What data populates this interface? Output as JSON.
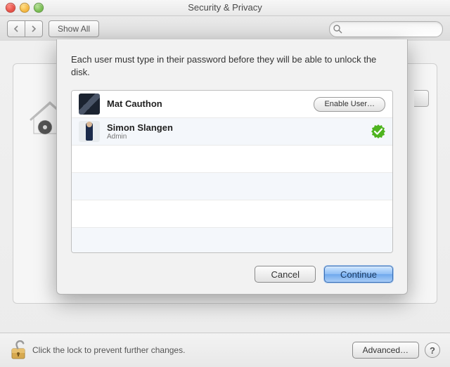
{
  "window": {
    "title": "Security & Privacy"
  },
  "toolbar": {
    "show_all": "Show All",
    "search_placeholder": ""
  },
  "sheet": {
    "message": "Each user must type in their password before they will be able to unlock the disk.",
    "users": [
      {
        "name": "Mat Cauthon",
        "role": "",
        "status": "disabled",
        "action_label": "Enable User…"
      },
      {
        "name": "Simon Slangen",
        "role": "Admin",
        "status": "enabled"
      }
    ],
    "cancel": "Cancel",
    "continue": "Continue"
  },
  "footer": {
    "lock_text": "Click the lock to prevent further changes.",
    "advanced": "Advanced…",
    "help": "?"
  }
}
